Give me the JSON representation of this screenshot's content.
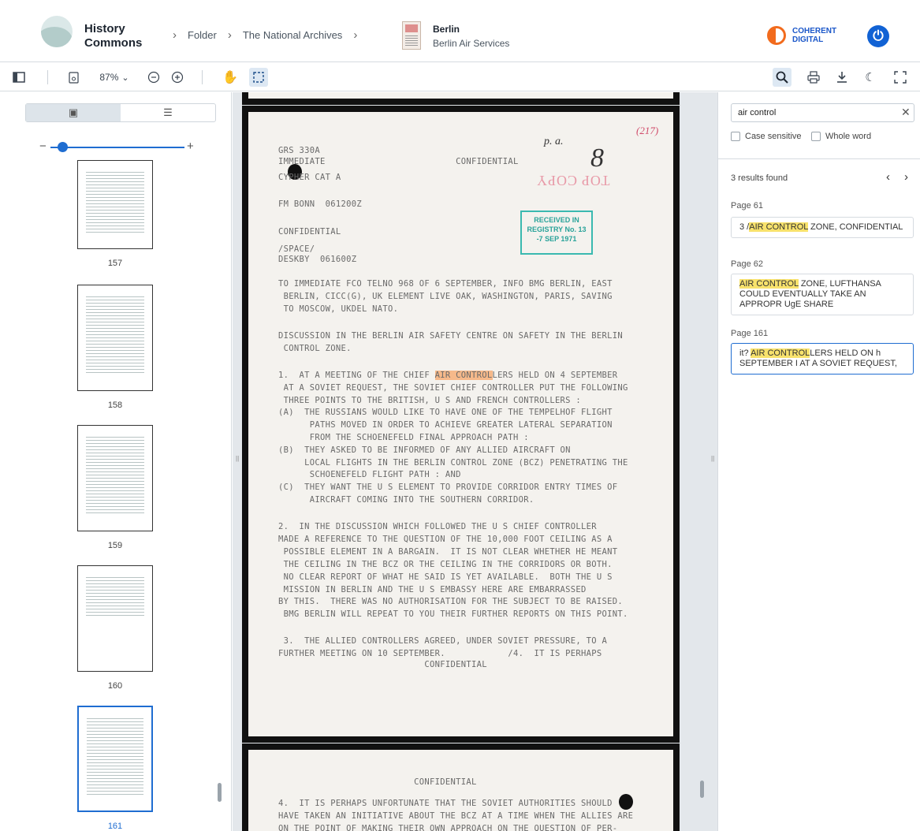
{
  "header": {
    "logo_line1": "History",
    "logo_line2": "Commons",
    "breadcrumbs": [
      "Folder",
      "The National Archives"
    ],
    "doc_title": "Berlin",
    "doc_subtitle": "Berlin Air Services",
    "brand_line1": "COHERENT",
    "brand_line2": "DIGITAL"
  },
  "toolbar": {
    "zoom": "87%",
    "zoom_caret": "⌄"
  },
  "thumbnails": [
    {
      "label": "157"
    },
    {
      "label": "158"
    },
    {
      "label": "159"
    },
    {
      "label": "160"
    },
    {
      "label": "161"
    }
  ],
  "search": {
    "query": "air control",
    "case_sensitive_label": "Case sensitive",
    "whole_word_label": "Whole word",
    "results_count": "3 results found",
    "results": [
      {
        "page": "Page 61",
        "before": "3 /",
        "match": "AIR CONTROL",
        "after": " ZONE, CONFIDENTIAL"
      },
      {
        "page": "Page 62",
        "before": "",
        "match": "AIR CONTROL",
        "after": " ZONE, LUFTHANSA COULD EVENTUALLY TAKE AN APPROPR UgE SHARE"
      },
      {
        "page": "Page 161",
        "before": "it? ",
        "match": "AIR CONTROL",
        "after": "LERS HELD ON h SEPTEMBER I AT A SOVIET REQUEST,"
      }
    ]
  },
  "document": {
    "page_mark": "(217)",
    "top_copy": "TOP COPY",
    "stamp_line1": "RECEIVED IN",
    "stamp_line2": "REGISTRY No. 13",
    "stamp_line3": "-7 SEP 1971",
    "l01": "GRS 330A",
    "l02": "IMMEDIATE                         CONFIDENTIAL",
    "l03": "CYPHER CAT A",
    "l04": "FM BONN  061200Z",
    "l05": "CONFIDENTIAL",
    "l06": "/SPACE/",
    "l07": "DESKBY  061600Z",
    "l08": "TO IMMEDIATE FCO TELNO 968 OF 6 SEPTEMBER, INFO BMG BERLIN, EAST",
    "l09": " BERLIN, CICC(G), UK ELEMENT LIVE OAK, WASHINGTON, PARIS, SAVING",
    "l10": " TO MOSCOW, UKDEL NATO.",
    "l11": "DISCUSSION IN THE BERLIN AIR SAFETY CENTRE ON SAFETY IN THE BERLIN",
    "l12": " CONTROL ZONE.",
    "l13a": "1.  AT A MEETING OF THE CHIEF ",
    "l13b": "AIR CONTROL",
    "l13c": "LERS HELD ON 4 SEPTEMBER",
    "l14": " AT A SOVIET REQUEST, THE SOVIET CHIEF CONTROLLER PUT THE FOLLOWING",
    "l15": " THREE POINTS TO THE BRITISH, U S AND FRENCH CONTROLLERS :",
    "l16": "(A)  THE RUSSIANS WOULD LIKE TO HAVE ONE OF THE TEMPELHOF FLIGHT",
    "l17": "      PATHS MOVED IN ORDER TO ACHIEVE GREATER LATERAL SEPARATION",
    "l18": "      FROM THE SCHOENEFELD FINAL APPROACH PATH :",
    "l19": "(B)  THEY ASKED TO BE INFORMED OF ANY ALLIED AIRCRAFT ON",
    "l20": "     LOCAL FLIGHTS IN THE BERLIN CONTROL ZONE (BCZ) PENETRATING THE",
    "l21": "      SCHOENEFELD FLIGHT PATH : AND",
    "l22": "(C)  THEY WANT THE U S ELEMENT TO PROVIDE CORRIDOR ENTRY TIMES OF",
    "l23": "      AIRCRAFT COMING INTO THE SOUTHERN CORRIDOR.",
    "l24": "2.  IN THE DISCUSSION WHICH FOLLOWED THE U S CHIEF CONTROLLER",
    "l25": "MADE A REFERENCE TO THE QUESTION OF THE 10,000 FOOT CEILING AS A",
    "l26": " POSSIBLE ELEMENT IN A BARGAIN.  IT IS NOT CLEAR WHETHER HE MEANT",
    "l27": " THE CEILING IN THE BCZ OR THE CEILING IN THE CORRIDORS OR BOTH.",
    "l28": " NO CLEAR REPORT OF WHAT HE SAID IS YET AVAILABLE.  BOTH THE U S",
    "l29": " MISSION IN BERLIN AND THE U S EMBASSY HERE ARE EMBARRASSED",
    "l30": "BY THIS.  THERE WAS NO AUTHORISATION FOR THE SUBJECT TO BE RAISED.",
    "l31": " BMG BERLIN WILL REPEAT TO YOU THEIR FURTHER REPORTS ON THIS POINT.",
    "l32": " 3.  THE ALLIED CONTROLLERS AGREED, UNDER SOVIET PRESSURE, TO A",
    "l33": "FURTHER MEETING ON 10 SEPTEMBER.            /4.  IT IS PERHAPS",
    "l34": "                            CONFIDENTIAL",
    "p2_l1": "                          CONFIDENTIAL",
    "p2_l2": "4.  IT IS PERHAPS UNFORTUNATE THAT THE SOVIET AUTHORITIES SHOULD",
    "p2_l3": "HAVE TAKEN AN INITIATIVE ABOUT THE BCZ AT A TIME WHEN THE ALLIES ARE",
    "p2_l4": "ON THE POINT OF MAKING THEIR OWN APPROACH ON THE QUESTION OF PER-"
  },
  "colors": {
    "accent": "#1f6dd1",
    "highlight": "#f8e26c",
    "brand_orange": "#f26b1d"
  }
}
